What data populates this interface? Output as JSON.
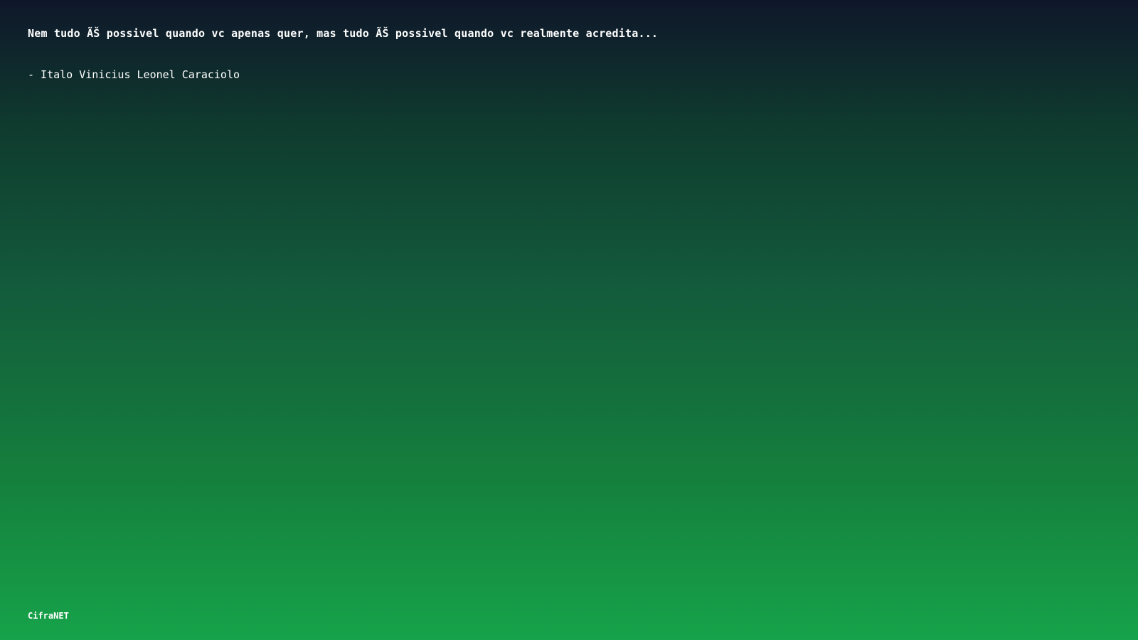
{
  "quote": {
    "text": "Nem tudo ÃŠ possivel quando vc apenas quer, mas tudo ÃŠ possivel quando vc realmente acredita...",
    "author": "- Italo Vinicius Leonel Caraciolo"
  },
  "footer": {
    "brand": "CifraNET"
  },
  "colors": {
    "background_top": "#0f172a",
    "background_bottom": "#16a34a",
    "text": "#ffffff"
  }
}
